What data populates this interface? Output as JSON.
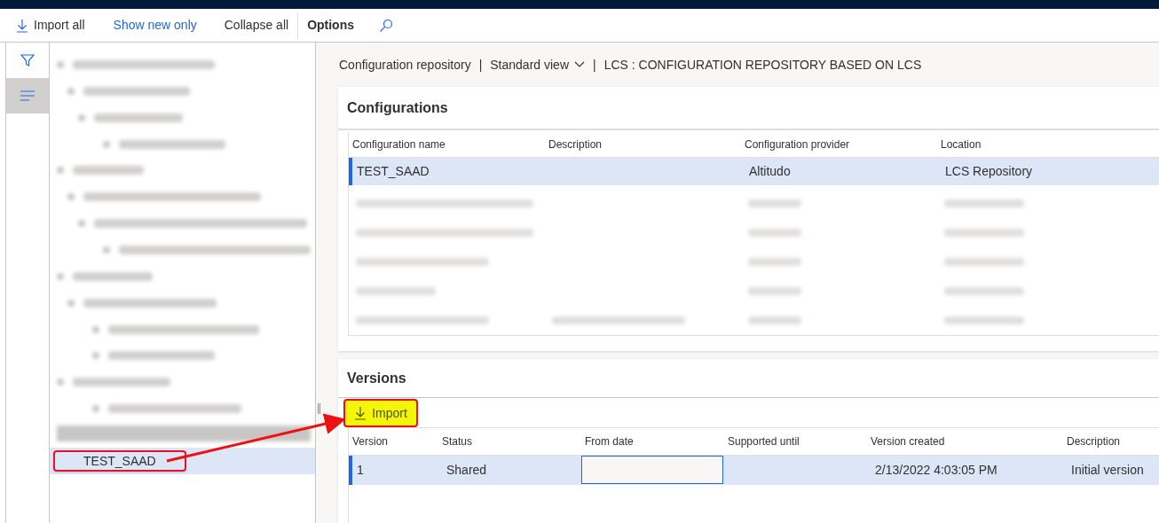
{
  "toolbar": [
    {
      "label": "Import all",
      "kind": "download"
    },
    {
      "label": "Show new only",
      "kind": "link"
    },
    {
      "label": "Collapse all",
      "kind": "plain"
    },
    {
      "label": "Options",
      "kind": "menu"
    }
  ],
  "side_rail": [
    {
      "kind": "filter",
      "selected": false
    },
    {
      "kind": "lines",
      "selected": true
    }
  ],
  "tree": {
    "selected_item": {
      "label": "TEST_SAAD",
      "selected": true,
      "highlighted": true
    }
  },
  "breadcrumb": [
    {
      "label": "Configuration repository",
      "kind": "text"
    },
    {
      "label": "|",
      "kind": "separator"
    },
    {
      "label": "Standard view",
      "kind": "dropdown"
    },
    {
      "label": "|",
      "kind": "separator"
    },
    {
      "label": "LCS : CONFIGURATION REPOSITORY BASED ON LCS",
      "kind": "text"
    }
  ],
  "configurations": {
    "title": "Configurations",
    "columns": [
      "Configuration name",
      "Description",
      "Configuration provider",
      "Location"
    ],
    "rows": [
      {
        "cells": [
          {
            "kind": "text",
            "text": "TEST_SAAD"
          },
          {
            "kind": "empty"
          },
          {
            "kind": "text",
            "text": "Altitudo"
          },
          {
            "kind": "text",
            "text": "LCS Repository"
          }
        ],
        "selected": true
      }
    ]
  },
  "versions": {
    "title": "Versions",
    "import_button": {
      "label": "Import",
      "highlighted": true
    },
    "columns": [
      "Version",
      "Status",
      "From date",
      "Supported until",
      "Version created",
      "Description"
    ],
    "rows": [
      {
        "selected": true,
        "cells": [
          {
            "kind": "text",
            "text": "1"
          },
          {
            "kind": "text",
            "text": "Shared"
          },
          {
            "kind": "input"
          },
          {
            "kind": "empty"
          },
          {
            "kind": "text",
            "text": "2/13/2022 4:03:05 PM"
          },
          {
            "kind": "text",
            "text": "Initial version"
          }
        ]
      }
    ]
  },
  "annotation": {
    "arrow": true
  }
}
